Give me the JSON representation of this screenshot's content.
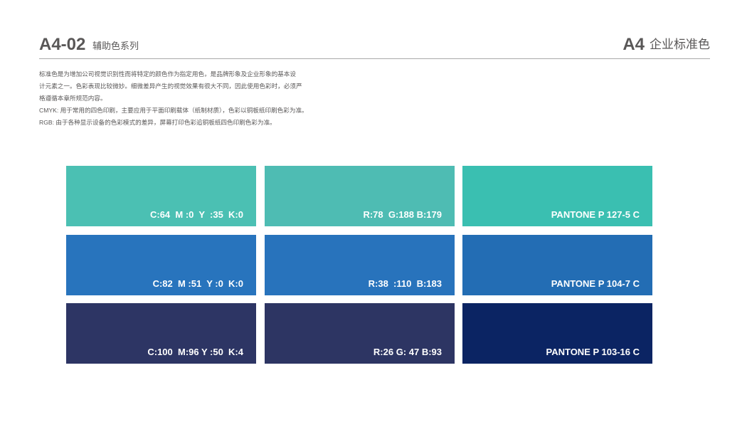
{
  "header": {
    "code": "A4-02",
    "subtitle": "辅助色系列",
    "section_code": "A4",
    "section_title": "企业标准色"
  },
  "intro": [
    "标准色是为增加公司视觉识别性而将特定的颜色作为指定用色，是品牌形象及企业形象的基本设",
    "计元素之一。色彩表现比较微妙。细微差异产生的视觉效果有很大不同，因此使用色彩时，必须严",
    "格遵循本章所规范内容。",
    "CMYK: 用于常用的四色印刷，主要应用于平面印刷载体（纸制材质），色彩以铜板纸印刷色彩为准。",
    "RGB: 由于各种显示设备的色彩模式的差异，屏幕打印色彩追铜板纸四色印刷色彩为准。"
  ],
  "swatches": [
    {
      "row": 0,
      "col": 0,
      "label": "C:64  M :0  Y  :35  K:0",
      "color": "#4bc0b3"
    },
    {
      "row": 0,
      "col": 1,
      "label": "R:78  G:188 B:179",
      "color": "#4ebcb3"
    },
    {
      "row": 0,
      "col": 2,
      "label": "PANTONE P 127-5 C",
      "color": "#3abfb1"
    },
    {
      "row": 1,
      "col": 0,
      "label": "C:82  M :51  Y :0  K:0",
      "color": "#2874bd"
    },
    {
      "row": 1,
      "col": 1,
      "label": "R:38  :110  B:183",
      "color": "#2873bc"
    },
    {
      "row": 1,
      "col": 2,
      "label": "PANTONE P 104-7 C",
      "color": "#236db4"
    },
    {
      "row": 2,
      "col": 0,
      "label": "C:100  M:96 Y :50  K:4",
      "color": "#2d3564"
    },
    {
      "row": 2,
      "col": 1,
      "label": "R:26 G: 47 B:93",
      "color": "#2d3563"
    },
    {
      "row": 2,
      "col": 2,
      "label": "PANTONE P 103-16 C",
      "color": "#0b2463"
    }
  ]
}
